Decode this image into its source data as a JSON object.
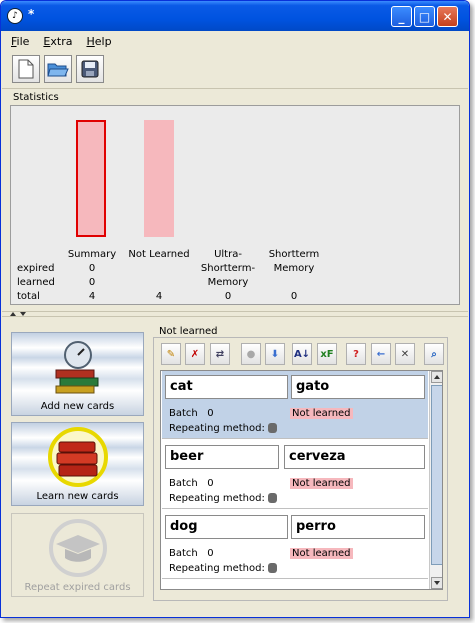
{
  "window": {
    "title": "*",
    "app_icon": "app-logo-icon"
  },
  "title_buttons": [
    {
      "name": "minimize-button",
      "icon": "minimize-icon",
      "glyph": "_"
    },
    {
      "name": "maximize-button",
      "icon": "maximize-icon",
      "glyph": "□"
    },
    {
      "name": "close-button",
      "icon": "close-icon",
      "glyph": "✕"
    }
  ],
  "menu": [
    {
      "key": "F",
      "rest": "ile"
    },
    {
      "key": "E",
      "rest": "xtra"
    },
    {
      "key": "H",
      "rest": "elp"
    }
  ],
  "toolbar": [
    {
      "name": "new-file-button",
      "icon": "new-document-icon"
    },
    {
      "name": "open-file-button",
      "icon": "open-folder-icon"
    },
    {
      "name": "save-file-button",
      "icon": "save-disk-icon"
    }
  ],
  "statistics": {
    "title": "Statistics",
    "row_labels": [
      "expired",
      "learned",
      "total"
    ],
    "columns": [
      {
        "label": "Summary",
        "label_lines": [
          "Summary"
        ],
        "expired": "0",
        "learned": "0",
        "total": "4",
        "bar_fraction": 0.78,
        "selected": true
      },
      {
        "label": "Not Learned",
        "label_lines": [
          "Not Learned"
        ],
        "expired": "",
        "learned": "",
        "total": "4",
        "bar_fraction": 0.78,
        "selected": false
      },
      {
        "label": "Ultra-Shortterm-Memory",
        "label_lines": [
          "Ultra-",
          "Shortterm-",
          "Memory"
        ],
        "expired": "",
        "learned": "",
        "total": "0",
        "bar_fraction": 0,
        "selected": false
      },
      {
        "label": "Shortterm Memory",
        "label_lines": [
          "Shortterm",
          "Memory"
        ],
        "expired": "",
        "learned": "",
        "total": "0",
        "bar_fraction": 0,
        "selected": false
      }
    ]
  },
  "side_buttons": [
    {
      "name": "add-new-cards-button",
      "label": "Add new cards",
      "icon": "stopwatch-books-icon",
      "enabled": true,
      "highlighted": false
    },
    {
      "name": "learn-new-cards-button",
      "label": "Learn new cards",
      "icon": "books-icon",
      "enabled": true,
      "highlighted": true
    },
    {
      "name": "repeat-expired-cards-button",
      "label": "Repeat expired cards",
      "icon": "graduation-cap-icon",
      "enabled": false,
      "highlighted": false
    }
  ],
  "card_panel": {
    "title": "Not learned",
    "icon_buttons": [
      {
        "name": "edit-card-button",
        "icon": "edit-pencil-icon",
        "glyph": "✎",
        "color": "#c08000"
      },
      {
        "name": "delete-card-button",
        "icon": "delete-card-icon",
        "glyph": "✗",
        "color": "#c00000"
      },
      {
        "name": "swap-sides-button",
        "icon": "swap-sides-icon",
        "glyph": "⇄",
        "color": "#404060"
      },
      {
        "name": "move-up-button",
        "icon": "up-circle-icon",
        "glyph": "●",
        "color": "#a8a8a8"
      },
      {
        "name": "move-down-button",
        "icon": "down-circle-icon",
        "glyph": "⬇",
        "color": "#3a6fd0"
      },
      {
        "name": "sort-button",
        "icon": "sort-az-icon",
        "glyph": "A↓",
        "color": "#203080"
      },
      {
        "name": "font-button",
        "icon": "font-xf-icon",
        "glyph": "xF",
        "color": "#208020"
      },
      {
        "name": "help-button",
        "icon": "help-question-icon",
        "glyph": "?",
        "color": "#d02020"
      },
      {
        "name": "back-button",
        "icon": "back-arrow-icon",
        "glyph": "←",
        "color": "#3a6fd0"
      },
      {
        "name": "remove-button",
        "icon": "remove-x-icon",
        "glyph": "✕",
        "color": "#404040"
      },
      {
        "name": "search-button",
        "icon": "search-magnifier-icon",
        "glyph": "⌕",
        "color": "#2060c0"
      }
    ],
    "cards": [
      {
        "front": "cat",
        "back": "gato",
        "batch_label": "Batch",
        "batch": "0",
        "status": "Not learned",
        "repeating_label": "Repeating method:",
        "repeating_icon": "hand-icon",
        "selected": true
      },
      {
        "front": "beer",
        "back": "cerveza",
        "batch_label": "Batch",
        "batch": "0",
        "status": "Not learned",
        "repeating_label": "Repeating method:",
        "repeating_icon": "hand-icon",
        "selected": false
      },
      {
        "front": "dog",
        "back": "perro",
        "batch_label": "Batch",
        "batch": "0",
        "status": "Not learned",
        "repeating_label": "Repeating method:",
        "repeating_icon": "hand-icon",
        "selected": false
      }
    ]
  }
}
